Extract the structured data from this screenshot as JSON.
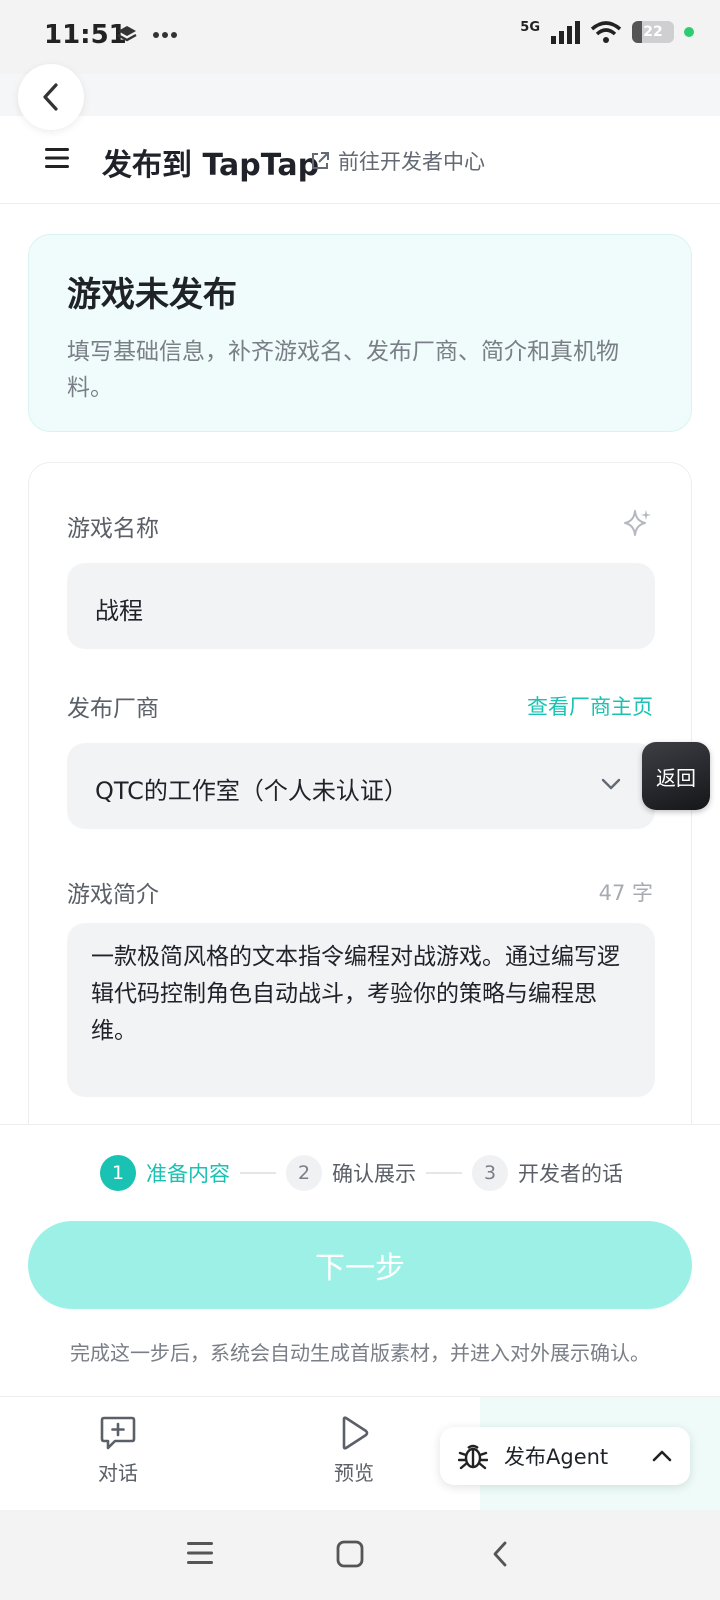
{
  "status_bar": {
    "time": "11:51",
    "network": "5G",
    "battery": "22"
  },
  "header": {
    "title": "发布到 TapTap",
    "dev_center_link": "前往开发者中心"
  },
  "status_card": {
    "title": "游戏未发布",
    "description": "填写基础信息，补齐游戏名、发布厂商、简介和真机物料。"
  },
  "form": {
    "game_name": {
      "label": "游戏名称",
      "value": "战程"
    },
    "publisher": {
      "label": "发布厂商",
      "link": "查看厂商主页",
      "value": "QTC的工作室（个人未认证）"
    },
    "intro": {
      "label": "游戏简介",
      "count": "47 字",
      "value": "一款极简风格的文本指令编程对战游戏。通过编写逻辑代码控制角色自动战斗，考验你的策略与编程思维。"
    }
  },
  "float_button": {
    "label": "返回"
  },
  "stepper": {
    "steps": [
      {
        "num": "1",
        "label": "准备内容",
        "active": true
      },
      {
        "num": "2",
        "label": "确认展示",
        "active": false
      },
      {
        "num": "3",
        "label": "开发者的话",
        "active": false
      }
    ]
  },
  "next_button": {
    "label": "下一步"
  },
  "hint": "完成这一步后，系统会自动生成首版素材，并进入对外展示确认。",
  "tabbar": {
    "chat": "对话",
    "preview": "预览",
    "agent": "发布Agent"
  },
  "colors": {
    "accent": "#19c2b2",
    "button_disabled": "#9df0e6",
    "card_bg": "#f0fcfb"
  }
}
